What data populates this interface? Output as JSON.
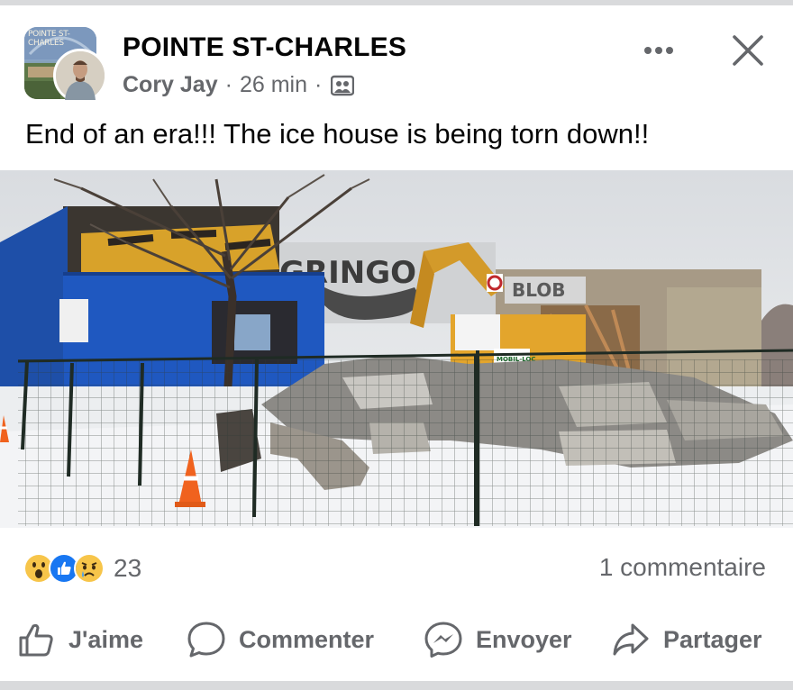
{
  "group": {
    "name": "POINTE ST-CHARLES",
    "avatar_text": "POINTE ST-CHARLES"
  },
  "post": {
    "author": "Cory Jay",
    "separator": "·",
    "time": "26 min",
    "audience_icon": "group-icon",
    "text": "End of an era!!! The ice house is being torn down!!"
  },
  "photo": {
    "graffiti": [
      "GRINGO",
      "BLOB"
    ],
    "sign_text": "MOBIL-LOC"
  },
  "engagement": {
    "reaction_icons": [
      "wow-emoji",
      "like-emoji",
      "sad-emoji"
    ],
    "reaction_count": "23",
    "comments_label": "1 commentaire"
  },
  "actions": {
    "like": "J'aime",
    "comment": "Commenter",
    "send": "Envoyer",
    "share": "Partager"
  },
  "colors": {
    "secondary_text": "#65676b",
    "like_blue": "#1877f2",
    "divider": "#d9dadc"
  }
}
